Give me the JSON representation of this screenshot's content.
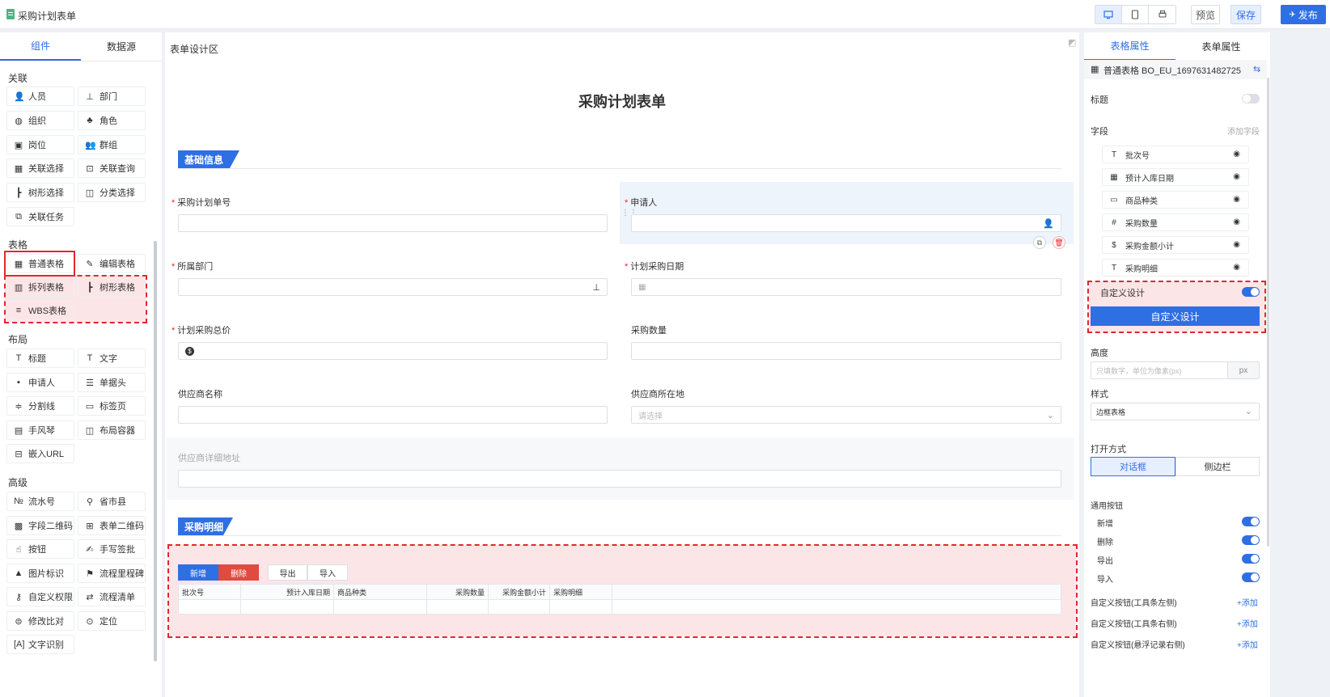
{
  "header": {
    "app_title": "采购计划表单",
    "devices": [
      "desktop-icon",
      "tablet-icon",
      "mobile-icon"
    ],
    "preview_label": "预览",
    "save_label": "保存",
    "publish_label": "发布"
  },
  "left": {
    "tabs": [
      "组件",
      "数据源"
    ],
    "sections": {
      "relation": "关联",
      "table": "表格",
      "layout": "布局",
      "advanced": "高级"
    },
    "components": {
      "person": "人员",
      "dept": "部门",
      "org": "组织",
      "role": "角色",
      "post": "岗位",
      "group": "群组",
      "rel_select": "关联选择",
      "rel_query": "关联查询",
      "tree_select": "树形选择",
      "cat_select": "分类选择",
      "rel_task": "关联任务",
      "normal_table": "普通表格",
      "edit_table": "编辑表格",
      "split_table": "拆列表格",
      "tree_table": "树形表格",
      "wbs_table": "WBS表格",
      "title": "标题",
      "text": "文字",
      "applicant": "申请人",
      "doc_head": "单据头",
      "divider": "分割线",
      "tab_page": "标签页",
      "accordion": "手风琴",
      "layout_container": "布局容器",
      "embed_url": "嵌入URL",
      "serial": "流水号",
      "province": "省市县",
      "field_qr": "字段二维码",
      "form_qr": "表单二维码",
      "button": "按钮",
      "hand_sign": "手写签批",
      "image_mark": "图片标识",
      "milestone": "流程里程碑",
      "custom_perm": "自定义权限",
      "flow_list": "流程清单",
      "diff": "修改比对",
      "locate": "定位",
      "ocr": "文字识别"
    }
  },
  "canvas": {
    "area_title": "表单设计区",
    "form_title": "采购计划表单",
    "section_basic": "基础信息",
    "section_detail": "采购明细",
    "fields": {
      "plan_no": "采购计划单号",
      "applicant": "申请人",
      "dept": "所属部门",
      "plan_date": "计划采购日期",
      "total_price": "计划采购总价",
      "quantity": "采购数量",
      "supplier_name": "供应商名称",
      "supplier_location": "供应商所在地",
      "supplier_location_placeholder": "请选择",
      "supplier_address": "供应商详细地址"
    },
    "table": {
      "buttons": [
        "新增",
        "删除",
        "导出",
        "导入"
      ],
      "columns": [
        "批次号",
        "预计入库日期",
        "商品种类",
        "采购数量",
        "采购金额小计",
        "采购明细"
      ]
    }
  },
  "right": {
    "tabs": [
      "表格属性",
      "表单属性"
    ],
    "table_name": "普通表格 BO_EU_1697631482725",
    "title_label": "标题",
    "title_on": false,
    "fields_label": "字段",
    "add_field": "添加字段",
    "field_items": [
      {
        "icon": "text-icon",
        "label": "批次号"
      },
      {
        "icon": "calendar-icon",
        "label": "预计入库日期"
      },
      {
        "icon": "input-icon",
        "label": "商品种类"
      },
      {
        "icon": "number-icon",
        "label": "采购数量"
      },
      {
        "icon": "money-icon",
        "label": "采购金额小计"
      },
      {
        "icon": "text-icon",
        "label": "采购明细"
      }
    ],
    "custom_design_label": "自定义设计",
    "custom_design_on": true,
    "custom_design_button": "自定义设计",
    "height_label": "高度",
    "height_placeholder": "只填数字，单位为像素(px)",
    "height_unit": "px",
    "style_label": "样式",
    "style_value": "边框表格",
    "open_label": "打开方式",
    "open_options": [
      "对话框",
      "侧边栏"
    ],
    "common_buttons_label": "通用按钮",
    "common_buttons": [
      {
        "label": "新增",
        "on": true
      },
      {
        "label": "删除",
        "on": true
      },
      {
        "label": "导出",
        "on": true
      },
      {
        "label": "导入",
        "on": true
      }
    ],
    "custom_buttons": [
      {
        "label": "自定义按钮(工具条左侧)",
        "add": "+添加"
      },
      {
        "label": "自定义按钮(工具条右侧)",
        "add": "+添加"
      },
      {
        "label": "自定义按钮(悬浮记录右侧)",
        "add": "+添加"
      }
    ]
  },
  "colors": {
    "primary": "#2f6fe4",
    "danger": "#e04a3f",
    "highlight_red": "#e0282e"
  }
}
